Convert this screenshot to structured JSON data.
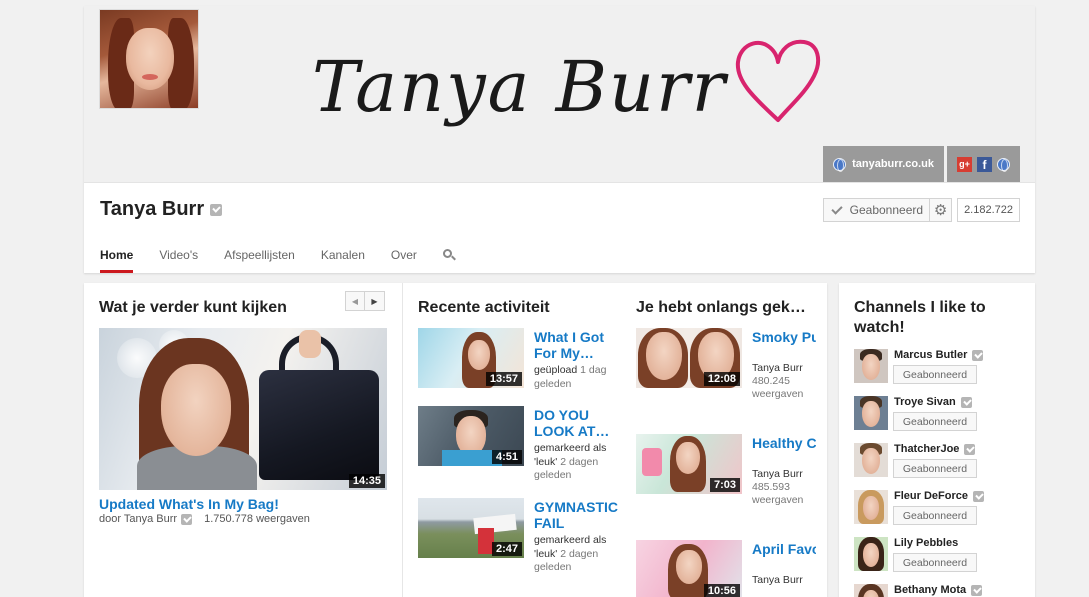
{
  "banner": {
    "logo_text": "Tanya Burr",
    "website_label": "tanyaburr.co.uk",
    "social_icons": [
      "google-plus-icon",
      "facebook-icon",
      "globe-icon"
    ]
  },
  "channel": {
    "name": "Tanya Burr",
    "subscribe_label": "Geabonneerd",
    "subscriber_count": "2.182.722"
  },
  "tabs": [
    {
      "label": "Home",
      "active": true
    },
    {
      "label": "Video's",
      "active": false
    },
    {
      "label": "Afspeellijsten",
      "active": false
    },
    {
      "label": "Kanalen",
      "active": false
    },
    {
      "label": "Over",
      "active": false
    }
  ],
  "feature": {
    "section_title": "Wat je verder kunt kijken",
    "duration": "14:35",
    "title": "Updated What's In My Bag!",
    "by": "door Tanya Burr",
    "views": "1.750.778 weergaven"
  },
  "activity": {
    "section_title": "Recente activiteit",
    "items": [
      {
        "title": "What I Got For My…",
        "duration": "13:57",
        "action": "geüpload",
        "time": "1 dag geleden"
      },
      {
        "title": "DO YOU LOOK AT…",
        "duration": "4:51",
        "action": "gemarkeerd als 'leuk'",
        "time": "2 dagen geleden"
      },
      {
        "title": "GYMNASTIC FAIL",
        "duration": "2:47",
        "action": "gemarkeerd als 'leuk'",
        "time": "2 dagen geleden"
      }
    ]
  },
  "recent": {
    "section_title": "Je hebt onlangs gek…",
    "items": [
      {
        "title": "Smoky Purpl…",
        "duration": "12:08",
        "author": "Tanya Burr",
        "views": "480.245",
        "views_label": "weergaven"
      },
      {
        "title": "Healthy Choc…",
        "duration": "7:03",
        "author": "Tanya Burr",
        "views": "485.593",
        "views_label": "weergaven"
      },
      {
        "title": "April Favo…",
        "duration": "10:56",
        "author": "Tanya Burr",
        "views": "",
        "views_label": ""
      }
    ]
  },
  "side": {
    "title": "Channels I like to watch!",
    "button_label": "Geabonneerd",
    "channels": [
      {
        "name": "Marcus Butler"
      },
      {
        "name": "Troye Sivan"
      },
      {
        "name": "ThatcherJoe"
      },
      {
        "name": "Fleur DeForce"
      },
      {
        "name": "Lily Pebbles"
      },
      {
        "name": "Bethany Mota"
      }
    ]
  },
  "colors": {
    "link_blue": "#167ac6",
    "tab_red": "#cc181e",
    "heart_pink": "#d8246e"
  }
}
